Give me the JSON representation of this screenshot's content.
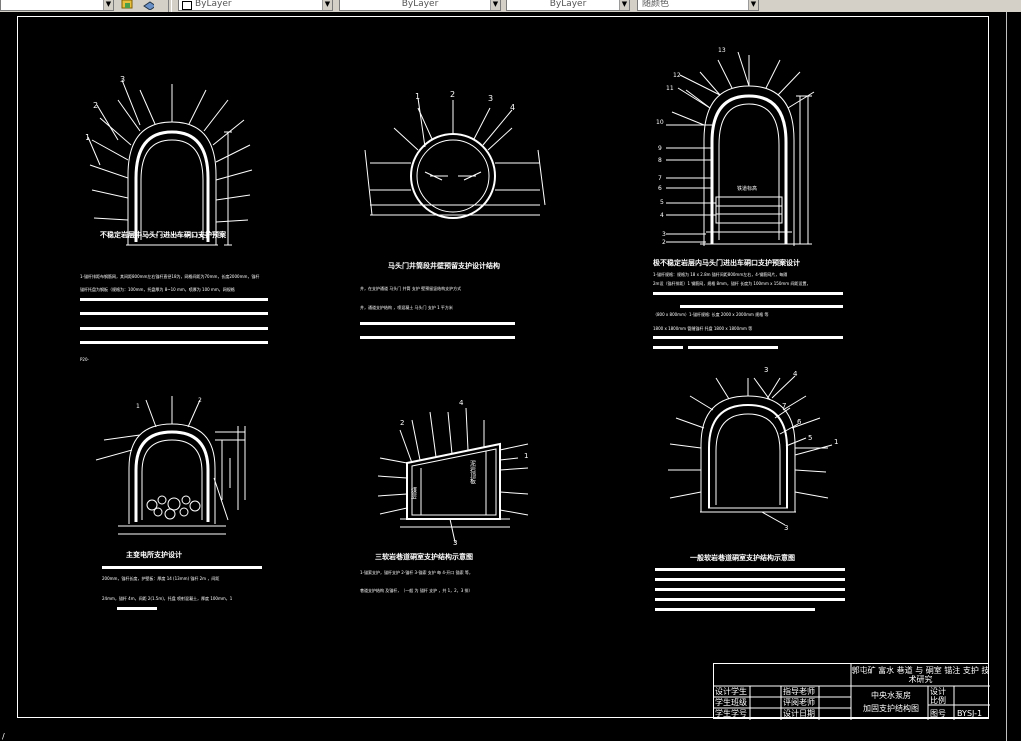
{
  "toolbar": {
    "layer_name": "",
    "color_value": "ByLayer",
    "linetype_value": "ByLayer",
    "lineweight_value": "ByLayer",
    "plotstyle_value": "随颜色"
  },
  "drawing": {
    "figure1": {
      "title": "不稳定岩层中马头门进出车硐口支护预案",
      "labels": [
        "1",
        "2",
        "3"
      ],
      "caption_line": "1-锚杆排距布钢筋网，其间距800mm左右锚杆直径18为，网格间距为70mm，长度2000mm，锚杆",
      "caption_line2": "锚杆托盘为钢板（规格为：100mm，托盘厚为 8~10 mm，喷厚为 100 mm，网规格",
      "note": "P20-"
    },
    "figure2": {
      "title": "马头门井筒段井壁预留支护设计结构",
      "labels": [
        "1",
        "2",
        "3",
        "4"
      ],
      "caption_line": "井，在支护通道 马头门 井筒 支护 壁预留竖结构支护方式",
      "caption_line2": "井，通道支护结构 ，喷混凝土 马头门 支护 1 平方米"
    },
    "figure3": {
      "title": "极不稳定岩层内马头门进出车硐口支护预案设计",
      "labels": [
        "12",
        "11",
        "10",
        "9",
        "8",
        "7",
        "6",
        "5",
        "4",
        "3",
        "2",
        "1",
        "13"
      ],
      "inner_label": "铁道标高",
      "caption_line": "1-锚杆规格：规格为 18 x 2.8m 锚杆间距800mm左右，4-钢筋网片，每隔",
      "caption_line2": "2m设（锚杆排距）1 钢筋网，规格 8mm，锚杆 长度为 100mm x 150mm 间距设置，",
      "caption_line3": "（800 x 800mm）1-锚杆规格: 长度 2000 x 2000mm 规格 等",
      "caption_line4": "1800 x 1800mm 管缝锚杆 托盘 1800 x 1800mm 等"
    },
    "figure4": {
      "title": "主变电所支护设计",
      "labels": [
        "1",
        "2"
      ],
      "caption_line": "200mm，锚杆长度，护壁板：厚度 14 (13mm) 锚杆 2m ，间距",
      "caption_line2": "24mm，锚杆 4m，间距 2(1.5m)，托盘 喷射混凝土，厚度 100mm，1"
    },
    "figure5": {
      "title": "三软岩巷道硐室支护结构示意图",
      "labels": [
        "2",
        "4",
        "1",
        "3"
      ],
      "inner_left": "煤层",
      "inner_right": "泥岩顶板",
      "caption_line": "1-锚索支护，锚杆支护 2-锚杆 3-锚索 支护 每 4-开口 锚索 等，",
      "caption_line2": "巷道支护结构 及锚杆，（一般 为 锚杆 支护 ，共 1，2，3 排）"
    },
    "figure6": {
      "title": "一般软岩巷道硐室支护结构示意图",
      "labels": [
        "3",
        "4",
        "7",
        "6",
        "5",
        "1",
        "3"
      ]
    }
  },
  "title_block": {
    "project_title": "郭屯矿 富水 巷道 与 硐室 锚注 支护 技术研究",
    "drawing_name_1": "中央水泵房",
    "drawing_name_2": "加固支护结构图",
    "left_labels": [
      "设计学生",
      "学生班级",
      "学生学号"
    ],
    "mid_labels": [
      "指导老师",
      "评阅老师",
      "设计日期"
    ],
    "right_labels": [
      "设计",
      "比例",
      "图号"
    ],
    "right_values": [
      "",
      "",
      "BYSJ-1"
    ]
  }
}
